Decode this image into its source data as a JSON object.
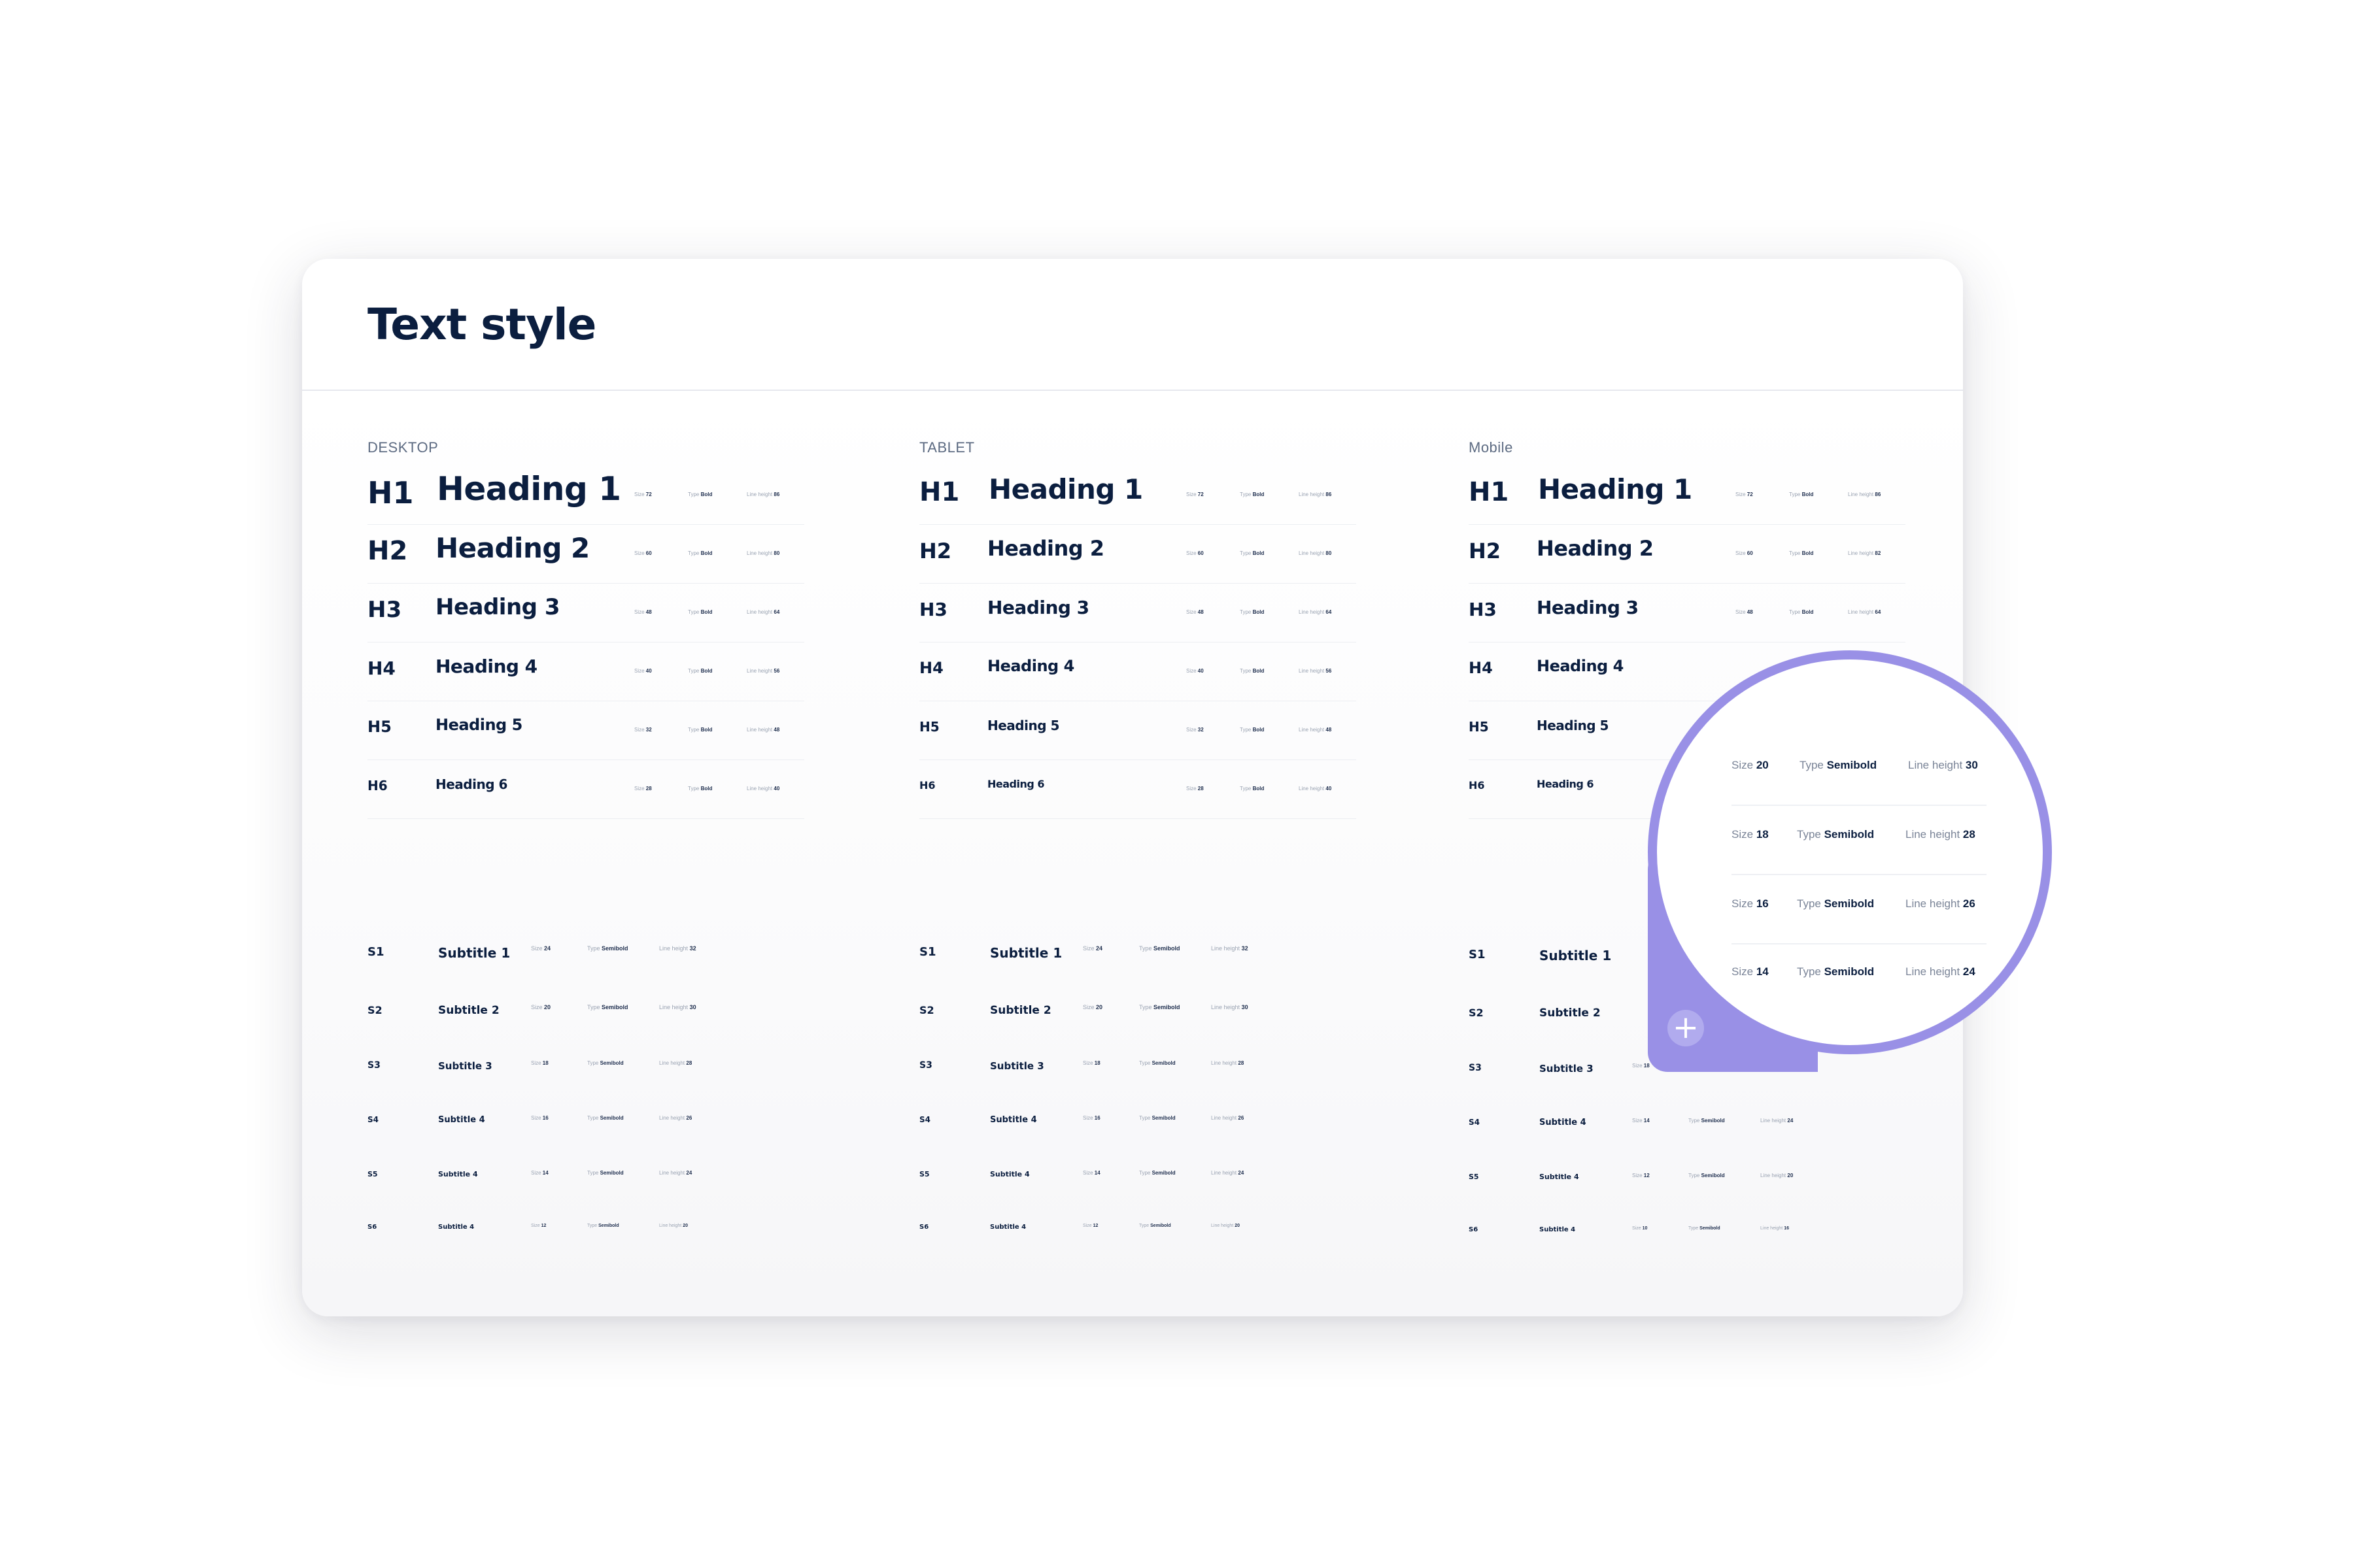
{
  "title": "Text style",
  "columns": [
    {
      "label": "DESKTOP",
      "headings": [
        {
          "tag": "H1",
          "name": "Heading 1",
          "size": "72",
          "type": "Bold",
          "line_height": "86"
        },
        {
          "tag": "H2",
          "name": "Heading 2",
          "size": "60",
          "type": "Bold",
          "line_height": "80"
        },
        {
          "tag": "H3",
          "name": "Heading 3",
          "size": "48",
          "type": "Bold",
          "line_height": "64"
        },
        {
          "tag": "H4",
          "name": "Heading 4",
          "size": "40",
          "type": "Bold",
          "line_height": "56"
        },
        {
          "tag": "H5",
          "name": "Heading 5",
          "size": "32",
          "type": "Bold",
          "line_height": "48"
        },
        {
          "tag": "H6",
          "name": "Heading 6",
          "size": "28",
          "type": "Bold",
          "line_height": "40"
        }
      ],
      "subtitles": [
        {
          "tag": "S1",
          "name": "Subtitle 1",
          "size": "24",
          "type": "Semibold",
          "line_height": "32"
        },
        {
          "tag": "S2",
          "name": "Subtitle 2",
          "size": "20",
          "type": "Semibold",
          "line_height": "30"
        },
        {
          "tag": "S3",
          "name": "Subtitle 3",
          "size": "18",
          "type": "Semibold",
          "line_height": "28"
        },
        {
          "tag": "S4",
          "name": "Subtitle 4",
          "size": "16",
          "type": "Semibold",
          "line_height": "26"
        },
        {
          "tag": "S5",
          "name": "Subtitle 4",
          "size": "14",
          "type": "Semibold",
          "line_height": "24"
        },
        {
          "tag": "S6",
          "name": "Subtitle 4",
          "size": "12",
          "type": "Semibold",
          "line_height": "20"
        }
      ]
    },
    {
      "label": "TABLET",
      "headings": [
        {
          "tag": "H1",
          "name": "Heading 1",
          "size": "72",
          "type": "Bold",
          "line_height": "86"
        },
        {
          "tag": "H2",
          "name": "Heading 2",
          "size": "60",
          "type": "Bold",
          "line_height": "80"
        },
        {
          "tag": "H3",
          "name": "Heading 3",
          "size": "48",
          "type": "Bold",
          "line_height": "64"
        },
        {
          "tag": "H4",
          "name": "Heading 4",
          "size": "40",
          "type": "Bold",
          "line_height": "56"
        },
        {
          "tag": "H5",
          "name": "Heading 5",
          "size": "32",
          "type": "Bold",
          "line_height": "48"
        },
        {
          "tag": "H6",
          "name": "Heading 6",
          "size": "28",
          "type": "Bold",
          "line_height": "40"
        }
      ],
      "subtitles": [
        {
          "tag": "S1",
          "name": "Subtitle 1",
          "size": "24",
          "type": "Semibold",
          "line_height": "32"
        },
        {
          "tag": "S2",
          "name": "Subtitle 2",
          "size": "20",
          "type": "Semibold",
          "line_height": "30"
        },
        {
          "tag": "S3",
          "name": "Subtitle 3",
          "size": "18",
          "type": "Semibold",
          "line_height": "28"
        },
        {
          "tag": "S4",
          "name": "Subtitle 4",
          "size": "16",
          "type": "Semibold",
          "line_height": "26"
        },
        {
          "tag": "S5",
          "name": "Subtitle 4",
          "size": "14",
          "type": "Semibold",
          "line_height": "24"
        },
        {
          "tag": "S6",
          "name": "Subtitle 4",
          "size": "12",
          "type": "Semibold",
          "line_height": "20"
        }
      ]
    },
    {
      "label": "Mobile",
      "headings": [
        {
          "tag": "H1",
          "name": "Heading 1",
          "size": "72",
          "type": "Bold",
          "line_height": "86"
        },
        {
          "tag": "H2",
          "name": "Heading 2",
          "size": "60",
          "type": "Bold",
          "line_height": "82"
        },
        {
          "tag": "H3",
          "name": "Heading 3",
          "size": "48",
          "type": "Bold",
          "line_height": "64"
        },
        {
          "tag": "H4",
          "name": "Heading 4",
          "size": "",
          "type": "",
          "line_height": ""
        },
        {
          "tag": "H5",
          "name": "Heading 5",
          "size": "",
          "type": "",
          "line_height": ""
        },
        {
          "tag": "H6",
          "name": "Heading 6",
          "size": "",
          "type": "",
          "line_height": ""
        }
      ],
      "subtitles": [
        {
          "tag": "S1",
          "name": "Subtitle 1",
          "size": "",
          "type": "",
          "line_height": ""
        },
        {
          "tag": "S2",
          "name": "Subtitle 2",
          "size": "",
          "type": "",
          "line_height": ""
        },
        {
          "tag": "S3",
          "name": "Subtitle 3",
          "size": "18",
          "type": "Semibold",
          "line_height": "28"
        },
        {
          "tag": "S4",
          "name": "Subtitle 4",
          "size": "14",
          "type": "Semibold",
          "line_height": "24"
        },
        {
          "tag": "S5",
          "name": "Subtitle 4",
          "size": "12",
          "type": "Semibold",
          "line_height": "20"
        },
        {
          "tag": "S6",
          "name": "Subtitle 4",
          "size": "10",
          "type": "Semibold",
          "line_height": "16"
        }
      ]
    }
  ],
  "meta_labels": {
    "size": "Size",
    "type": "Type",
    "line_height": "Line height"
  },
  "zoom": {
    "rows": [
      {
        "size": "20",
        "type": "Semibold",
        "line_height": "30"
      },
      {
        "size": "18",
        "type": "Semibold",
        "line_height": "28"
      },
      {
        "size": "16",
        "type": "Semibold",
        "line_height": "26"
      },
      {
        "size": "14",
        "type": "Semibold",
        "line_height": "24"
      }
    ],
    "add_button": "+"
  },
  "colors": {
    "navy": "#0b1e3f",
    "accent": "#9990e6",
    "muted": "#9aa3b2"
  }
}
